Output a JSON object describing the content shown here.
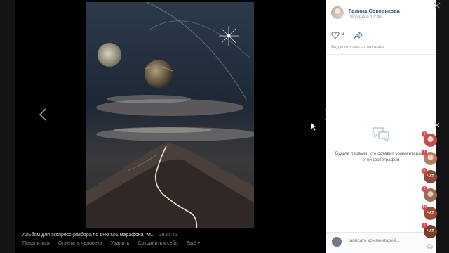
{
  "author": {
    "name": "Галина Соковикова",
    "time": "сегодня в 12:46"
  },
  "likes": {
    "count": "3"
  },
  "edit_description_label": "Редактировать описание",
  "empty_comments_text": "Будьте первым, кто оставит комментарий к этой фотографии",
  "comment_placeholder": "Написать комментарий...",
  "album": {
    "title": "Альбом для экспресс-разбора по дню №1 марафона \"М...",
    "counter": "39 из 73"
  },
  "photo_actions": [
    "Поделиться",
    "Отметить человека",
    "Удалить",
    "Сохранить к себе",
    "Ещё"
  ],
  "chats": [
    {
      "badge": "1",
      "label": "",
      "color": "#c94b4b"
    },
    {
      "badge": "2",
      "label": "",
      "color": "#b87c63"
    },
    {
      "badge": "6",
      "label": "ЧАТ",
      "color": "#8f4a3a"
    },
    {
      "badge": "2",
      "label": "",
      "color": "#a06b55"
    },
    {
      "badge": "14",
      "label": "ЧАТ",
      "color": "#9c4d34"
    },
    {
      "badge": "1",
      "label": "ЧАТ",
      "color": "#7a3e2d"
    }
  ],
  "colors": {
    "link": "#2a5885",
    "muted": "#939393",
    "badge": "#e64646",
    "background": "#141414"
  }
}
